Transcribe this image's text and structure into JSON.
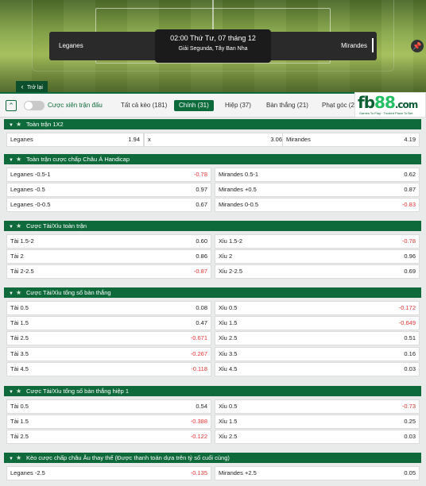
{
  "header": {
    "home_team": "Leganes",
    "away_team": "Mirandes",
    "datetime": "02:00 Thứ Tư, 07 tháng 12",
    "league": "Giải Segunda, Tây Ban Nha",
    "back_label": "Trở lại"
  },
  "tabs": {
    "parlay_label": "Cược xiên trận đấu",
    "items": [
      "Tất cả kèo (181)",
      "Chính (31)",
      "Hiệp (37)",
      "Bàn thắng (21)",
      "Phạt góc (25"
    ],
    "active": "Chính (31)"
  },
  "logo": {
    "text_a": "fb",
    "text_b": "88",
    "text_c": ".com",
    "tagline": "Games To Play · Trusted Place To Bet"
  },
  "sections": [
    {
      "title": "Toàn trận 1X2",
      "type": "three",
      "rows": [
        {
          "a": "Leganes",
          "av": "1.94",
          "b": "x",
          "bv": "3.06",
          "c": "Mirandes",
          "cv": "4.19"
        }
      ]
    },
    {
      "title": "Toàn trận cược chấp Châu Á Handicap",
      "type": "two",
      "rows": [
        {
          "l": "Leganes",
          "lh": "-0.5-1",
          "lv": "-0.78",
          "r": "Mirandes",
          "rh": "0.5-1",
          "rv": "0.62"
        },
        {
          "l": "Leganes",
          "lh": "-0.5",
          "lv": "0.97",
          "r": "Mirandes",
          "rh": "+0.5",
          "rv": "0.87"
        },
        {
          "l": "Leganes",
          "lh": "-0-0.5",
          "lv": "0.67",
          "r": "Mirandes",
          "rh": "0-0.5",
          "rv": "-0.83"
        }
      ]
    },
    {
      "title": "Cược Tài/Xỉu toàn trận",
      "type": "two",
      "rows": [
        {
          "l": "Tài",
          "lh": "1.5-2",
          "lv": "0.60",
          "r": "Xỉu",
          "rh": "1.5-2",
          "rv": "-0.78"
        },
        {
          "l": "Tài",
          "lh": "2",
          "lv": "0.86",
          "r": "Xỉu",
          "rh": "2",
          "rv": "0.96"
        },
        {
          "l": "Tài",
          "lh": "2-2.5",
          "lv": "-0.87",
          "r": "Xỉu",
          "rh": "2-2.5",
          "rv": "0.69"
        }
      ]
    },
    {
      "title": "Cược Tài/Xỉu tổng số bàn thắng",
      "type": "two",
      "rows": [
        {
          "l": "Tài",
          "lh": "0.5",
          "lv": "0.08",
          "r": "Xỉu",
          "rh": "0.5",
          "rv": "-0.172"
        },
        {
          "l": "Tài",
          "lh": "1.5",
          "lv": "0.47",
          "r": "Xỉu",
          "rh": "1.5",
          "rv": "-0.649"
        },
        {
          "l": "Tài",
          "lh": "2.5",
          "lv": "-0.671",
          "r": "Xỉu",
          "rh": "2.5",
          "rv": "0.51"
        },
        {
          "l": "Tài",
          "lh": "3.5",
          "lv": "-0.267",
          "r": "Xỉu",
          "rh": "3.5",
          "rv": "0.16"
        },
        {
          "l": "Tài",
          "lh": "4.5",
          "lv": "-0.118",
          "r": "Xỉu",
          "rh": "4.5",
          "rv": "0.03"
        }
      ]
    },
    {
      "title": "Cược Tài/Xỉu tổng số bàn thắng hiệp 1",
      "type": "two",
      "rows": [
        {
          "l": "Tài",
          "lh": "0.5",
          "lv": "0.54",
          "r": "Xỉu",
          "rh": "0.5",
          "rv": "-0.73"
        },
        {
          "l": "Tài",
          "lh": "1.5",
          "lv": "-0.388",
          "r": "Xỉu",
          "rh": "1.5",
          "rv": "0.25"
        },
        {
          "l": "Tài",
          "lh": "2.5",
          "lv": "-0.122",
          "r": "Xỉu",
          "rh": "2.5",
          "rv": "0.03"
        }
      ]
    },
    {
      "title": "Kèo cược chấp châu Âu thay thế (Được thanh toán dựa trên tỷ số cuối cùng)",
      "type": "two",
      "rows": [
        {
          "l": "Leganes",
          "lh": "-2.5",
          "lv": "-0.135",
          "r": "Mirandes",
          "rh": "+2.5",
          "rv": "0.05"
        }
      ]
    }
  ],
  "colors": {
    "brand_green": "#0f6a3b",
    "negative": "#e23434"
  }
}
